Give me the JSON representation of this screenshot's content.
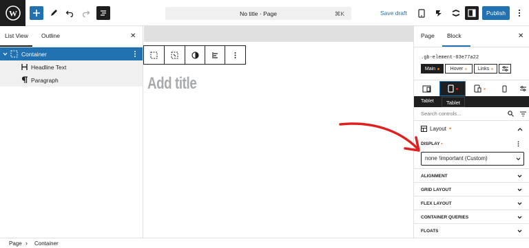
{
  "topbar": {
    "document_title": "No title · Page",
    "shortcut": "⌘K",
    "save_draft": "Save draft",
    "publish": "Publish"
  },
  "left_panel": {
    "tabs": [
      "List View",
      "Outline"
    ],
    "active_tab": "List View",
    "items": [
      {
        "label": "Container",
        "icon": "container-icon",
        "selected": true
      },
      {
        "label": "Headline Text",
        "icon": "heading-icon"
      },
      {
        "label": "Paragraph",
        "icon": "paragraph-icon"
      }
    ]
  },
  "canvas": {
    "title_placeholder": "Add title"
  },
  "right_panel": {
    "tabs": [
      "Page",
      "Block"
    ],
    "active_tab": "Block",
    "class_name": ".gb-element-03e77a22",
    "states": [
      "Main",
      "Hover",
      "Links"
    ],
    "device_tooltip": "Tablet",
    "device_label": "Tablet",
    "search_placeholder": "Search controls...",
    "layout_title": "Layout",
    "display_label": "DISPLAY",
    "display_value": "none !important (Custom)",
    "sections": [
      "ALIGNMENT",
      "GRID LAYOUT",
      "FLEX LAYOUT",
      "CONTAINER QUERIES",
      "FLOATS"
    ]
  },
  "breadcrumb": [
    "Page",
    "Container"
  ],
  "colors": {
    "accent": "#2271b1",
    "dark": "#1e1e1e",
    "modified_dot": "#e07b00",
    "arrow": "#e02020"
  }
}
